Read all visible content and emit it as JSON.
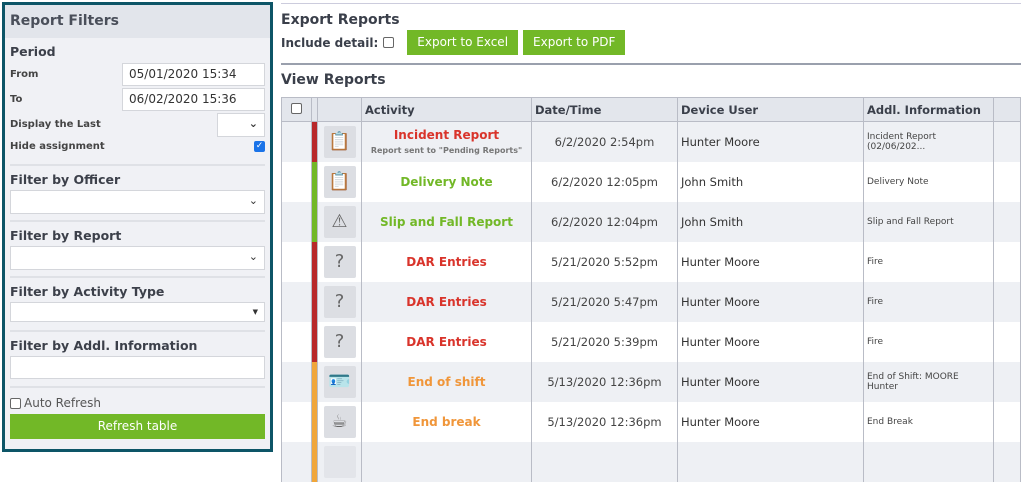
{
  "filters": {
    "title": "Report Filters",
    "period": "Period",
    "from_label": "From",
    "from_value": "05/01/2020 15:34",
    "to_label": "To",
    "to_value": "06/02/2020 15:36",
    "display_last_label": "Display the Last",
    "hide_assignment_label": "Hide assignment",
    "hide_assignment_checked": true,
    "officer_label": "Filter by Officer",
    "report_label": "Filter by Report",
    "activity_type_label": "Filter by Activity Type",
    "addl_info_label": "Filter by Addl. Information",
    "auto_refresh_label": "Auto Refresh",
    "refresh_button": "Refresh table"
  },
  "export": {
    "title": "Export Reports",
    "include_detail": "Include detail:",
    "excel": "Export to Excel",
    "pdf": "Export to PDF"
  },
  "view": {
    "title": "View Reports",
    "columns": [
      "Activity",
      "Date/Time",
      "Device User",
      "Addl. Information"
    ],
    "rows": [
      {
        "activity": "Incident Report",
        "sub": "Report sent to \"Pending Reports\"",
        "datetime": "6/2/2020 2:54pm",
        "user": "Hunter Moore",
        "addl": "Incident Report (02/06/202...",
        "color": "#d9342b",
        "bar": "#b8282a",
        "icon": "clipboard-icon",
        "glyph": "📋"
      },
      {
        "activity": "Delivery Note",
        "sub": "",
        "datetime": "6/2/2020 12:05pm",
        "user": "John Smith",
        "addl": "Delivery Note",
        "color": "#72b827",
        "bar": "#72b827",
        "icon": "clipboard-icon",
        "glyph": "📋"
      },
      {
        "activity": "Slip and Fall Report",
        "sub": "",
        "datetime": "6/2/2020 12:04pm",
        "user": "John Smith",
        "addl": "Slip and Fall Report",
        "color": "#72b827",
        "bar": "#72b827",
        "icon": "warning-icon",
        "glyph": "⚠"
      },
      {
        "activity": "DAR Entries",
        "sub": "",
        "datetime": "5/21/2020 5:52pm",
        "user": "Hunter Moore",
        "addl": "Fire",
        "color": "#d9342b",
        "bar": "#b8282a",
        "icon": "clipboard-question-icon",
        "glyph": "?"
      },
      {
        "activity": "DAR Entries",
        "sub": "",
        "datetime": "5/21/2020 5:47pm",
        "user": "Hunter Moore",
        "addl": "Fire",
        "color": "#d9342b",
        "bar": "#b8282a",
        "icon": "clipboard-question-icon",
        "glyph": "?"
      },
      {
        "activity": "DAR Entries",
        "sub": "",
        "datetime": "5/21/2020 5:39pm",
        "user": "Hunter Moore",
        "addl": "Fire",
        "color": "#d9342b",
        "bar": "#b8282a",
        "icon": "clipboard-question-icon",
        "glyph": "?"
      },
      {
        "activity": "End of shift",
        "sub": "",
        "datetime": "5/13/2020 12:36pm",
        "user": "Hunter Moore",
        "addl": "End of Shift: MOORE Hunter",
        "color": "#f0963a",
        "bar": "#f0a63a",
        "icon": "id-card-exit-icon",
        "glyph": "🪪"
      },
      {
        "activity": "End break",
        "sub": "",
        "datetime": "5/13/2020 12:36pm",
        "user": "Hunter Moore",
        "addl": "End Break",
        "color": "#f0963a",
        "bar": "#f0a63a",
        "icon": "coffee-cup-exit-icon",
        "glyph": "☕"
      },
      {
        "activity": "",
        "sub": "",
        "datetime": "",
        "user": "",
        "addl": "",
        "color": "#f0963a",
        "bar": "#f0a63a",
        "icon": "id-card-icon",
        "glyph": ""
      }
    ]
  }
}
